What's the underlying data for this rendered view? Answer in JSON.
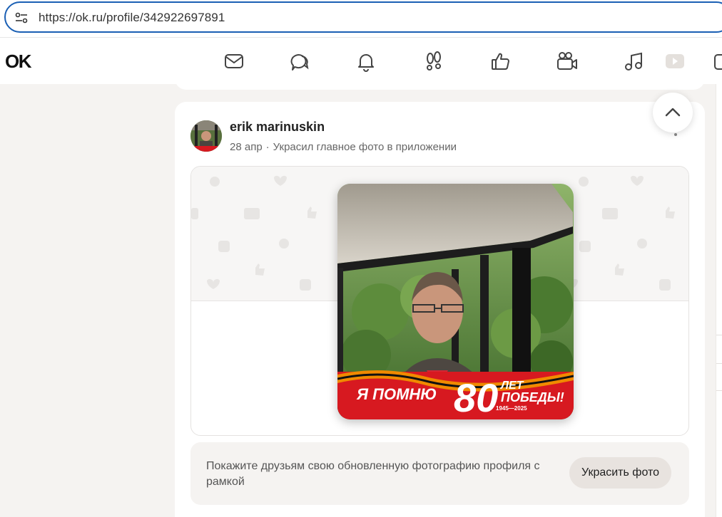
{
  "browser": {
    "url": "https://ok.ru/profile/342922697891"
  },
  "header": {
    "logo": "OK",
    "nav": [
      {
        "icon": "mail-icon"
      },
      {
        "icon": "chat-icon"
      },
      {
        "icon": "bell-icon"
      },
      {
        "icon": "footprints-icon"
      },
      {
        "icon": "thumbs-up-icon"
      },
      {
        "icon": "video-camera-icon"
      },
      {
        "icon": "music-icon"
      },
      {
        "icon": "video-play-icon"
      },
      {
        "icon": "more-icon"
      }
    ]
  },
  "post": {
    "author": "erik marinuskin",
    "date": "28 апр",
    "action": "Украсил главное фото в приложении",
    "photo_banner": {
      "left_text": "Я ПОМНЮ",
      "number": "80",
      "right_line1": "ЛЕТ",
      "right_line2": "ПОБЕДЫ!",
      "years": "1945—2025"
    },
    "promo_text": "Покажите друзьям свою обновленную фотографию профиля с рамкой",
    "promo_button": "Украсить фото"
  },
  "colors": {
    "accent_red": "#d71920",
    "ribbon_orange": "#f08a00",
    "focus_blue": "#1a5fb4"
  }
}
